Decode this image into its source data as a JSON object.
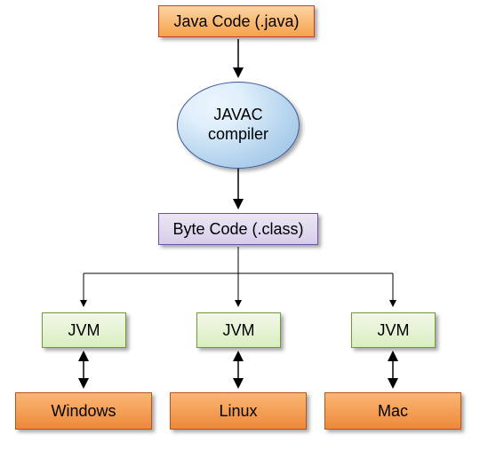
{
  "nodes": {
    "java_code": "Java Code (.java)",
    "compiler_line1": "JAVAC",
    "compiler_line2": "compiler",
    "byte_code": "Byte Code (.class)",
    "jvm1": "JVM",
    "jvm2": "JVM",
    "jvm3": "JVM",
    "os1": "Windows",
    "os2": "Linux",
    "os3": "Mac"
  },
  "chart_data": {
    "type": "diagram",
    "title": "",
    "flow": [
      {
        "from": "Java Code (.java)",
        "to": "JAVAC compiler",
        "style": "arrow"
      },
      {
        "from": "JAVAC compiler",
        "to": "Byte Code (.class)",
        "style": "arrow"
      },
      {
        "from": "Byte Code (.class)",
        "to": "JVM (Windows)",
        "style": "arrow"
      },
      {
        "from": "Byte Code (.class)",
        "to": "JVM (Linux)",
        "style": "arrow"
      },
      {
        "from": "Byte Code (.class)",
        "to": "JVM (Mac)",
        "style": "arrow"
      },
      {
        "from": "JVM (Windows)",
        "to": "Windows",
        "style": "double-arrow"
      },
      {
        "from": "JVM (Linux)",
        "to": "Linux",
        "style": "double-arrow"
      },
      {
        "from": "JVM (Mac)",
        "to": "Mac",
        "style": "double-arrow"
      }
    ],
    "node_styles": {
      "Java Code (.java)": "orange-rect",
      "JAVAC compiler": "blue-ellipse",
      "Byte Code (.class)": "purple-rect",
      "JVM": "green-rect",
      "Windows": "orange-rect",
      "Linux": "orange-rect",
      "Mac": "orange-rect"
    }
  }
}
